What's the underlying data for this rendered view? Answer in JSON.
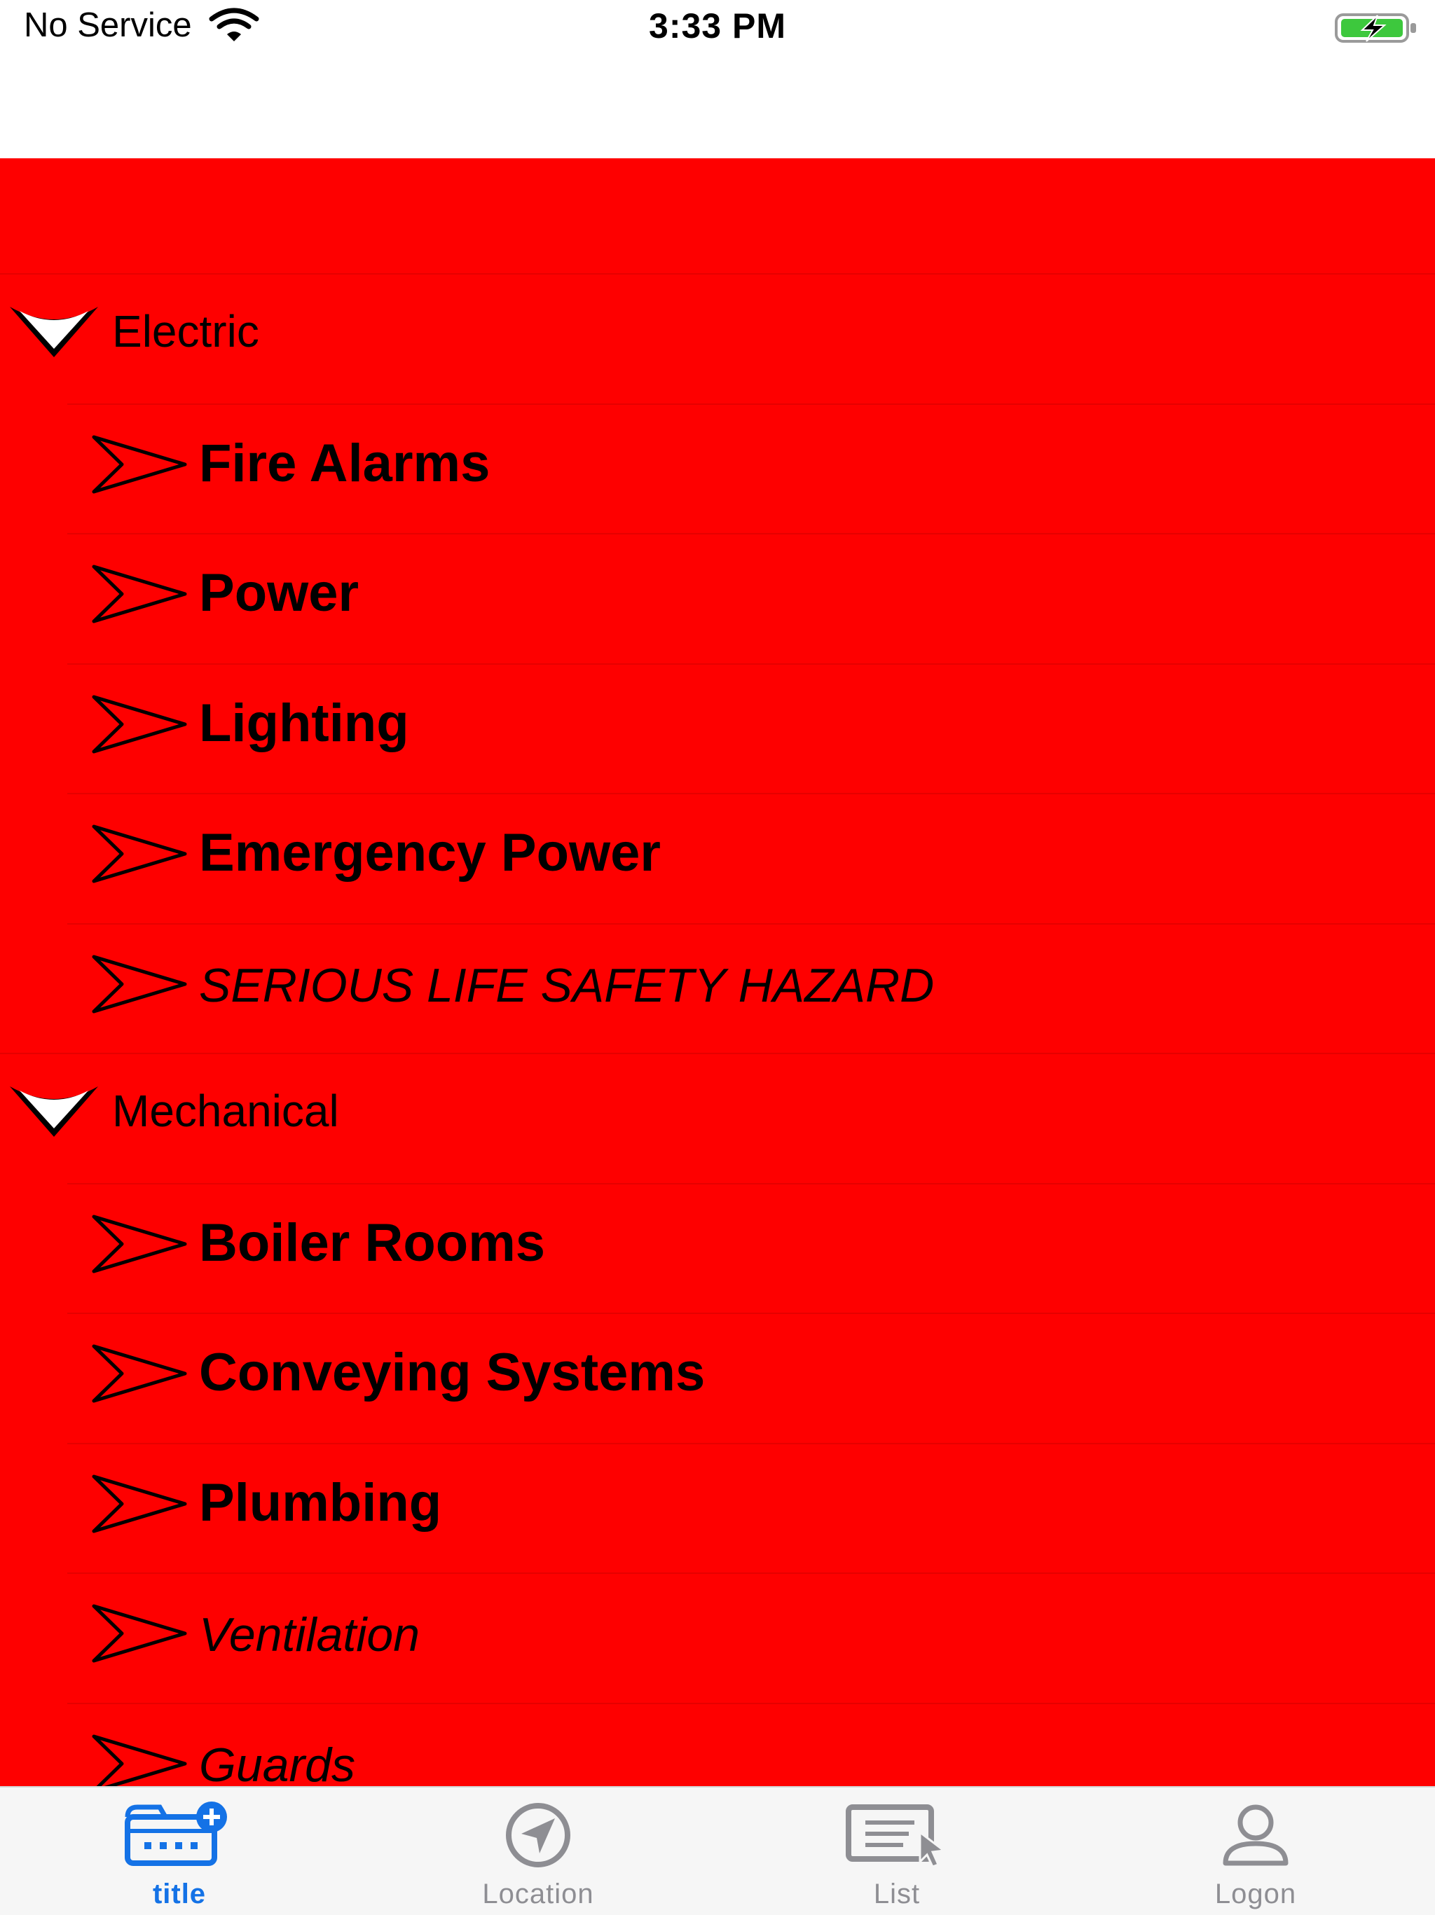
{
  "status_bar": {
    "carrier": "No Service",
    "time": "3:33 PM",
    "battery_color": "#3dc83d"
  },
  "theme": {
    "content_background": "#fe0000",
    "tab_active_color": "#1472e6",
    "tab_inactive_color": "#8e8e93"
  },
  "sections": [
    {
      "label": "Electric",
      "items": [
        {
          "label": "Fire Alarms"
        },
        {
          "label": "Power"
        },
        {
          "label": "Lighting"
        },
        {
          "label": "Emergency Power"
        },
        {
          "label": "SERIOUS LIFE SAFETY HAZARD"
        }
      ]
    },
    {
      "label": "Mechanical",
      "items": [
        {
          "label": "Boiler Rooms"
        },
        {
          "label": "Conveying Systems"
        },
        {
          "label": "Plumbing"
        },
        {
          "label": "Ventilation"
        },
        {
          "label": "Guards"
        }
      ]
    }
  ],
  "tabbar": {
    "tabs": [
      {
        "label": "title",
        "icon": "calendar-add-icon",
        "active": true
      },
      {
        "label": "Location",
        "icon": "location-arrow-icon",
        "active": false
      },
      {
        "label": "List",
        "icon": "list-cursor-icon",
        "active": false
      },
      {
        "label": "Logon",
        "icon": "person-icon",
        "active": false
      }
    ]
  }
}
